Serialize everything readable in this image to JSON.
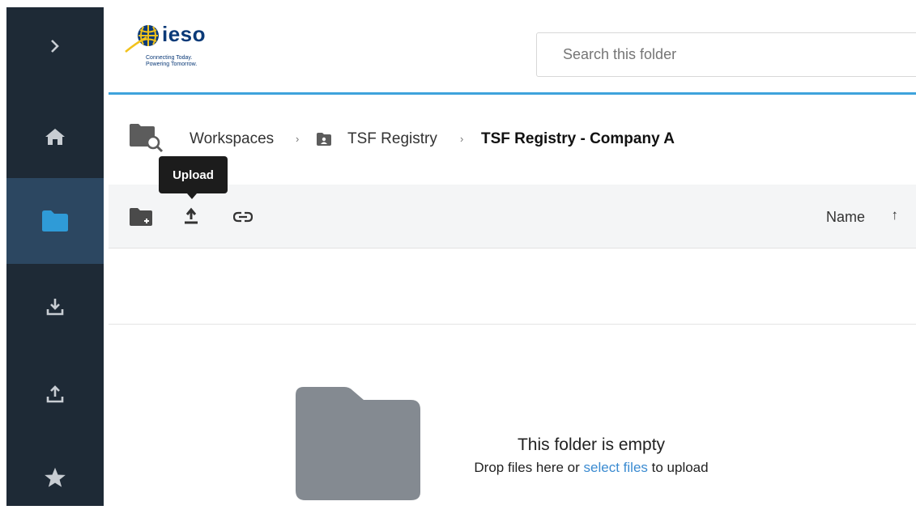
{
  "sidebar": {
    "items": [
      {
        "icon": "chevron-right-icon"
      },
      {
        "icon": "home-icon"
      },
      {
        "icon": "folder-icon",
        "active": true
      },
      {
        "icon": "download-icon"
      },
      {
        "icon": "upload-icon"
      },
      {
        "icon": "star-icon"
      }
    ]
  },
  "header": {
    "logo_name": "ieso",
    "logo_tagline_1": "Connecting Today.",
    "logo_tagline_2": "Powering Tomorrow.",
    "search_placeholder": "Search this folder"
  },
  "breadcrumb": {
    "items": [
      "Workspaces",
      "TSF Registry",
      "TSF Registry - Company A"
    ],
    "separator": "›"
  },
  "toolbar": {
    "tooltip": "Upload",
    "sort_label": "Name",
    "sort_direction_glyph": "↑"
  },
  "empty_state": {
    "title": "This folder is empty",
    "sub_prefix": "Drop files here or ",
    "sub_link": "select files",
    "sub_suffix": " to upload"
  },
  "colors": {
    "sidebar_bg": "#1e2a36",
    "sidebar_active": "#2c4761",
    "folder_accent": "#2f9bd7",
    "header_rule": "#3ea3dc",
    "link": "#3b8bd1"
  }
}
